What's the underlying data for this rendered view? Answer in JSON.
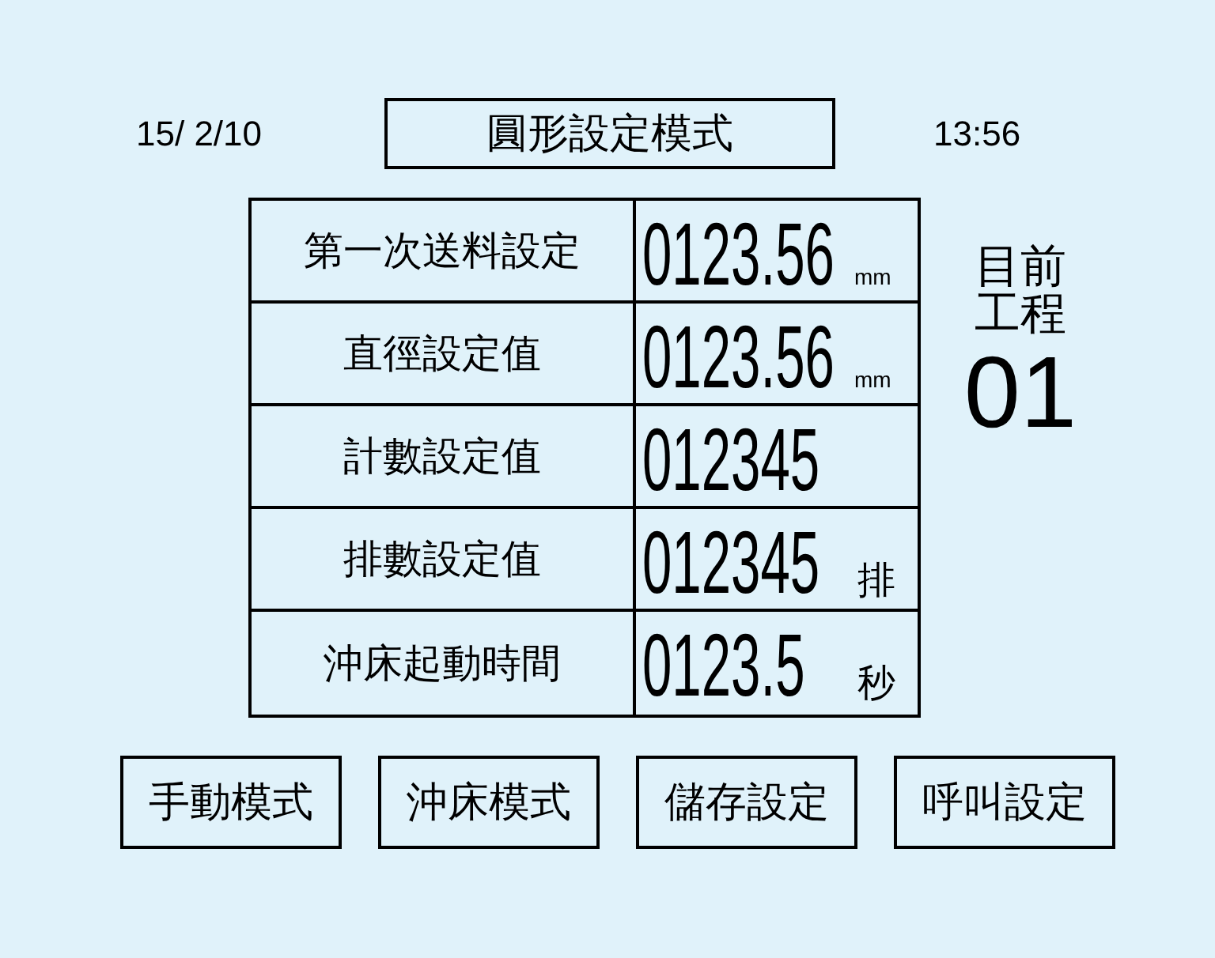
{
  "header": {
    "date": "15/ 2/10",
    "mode_title": "圓形設定模式",
    "time": "13:56"
  },
  "settings": [
    {
      "label": "第一次送料設定",
      "value": "0123.56",
      "unit": "mm",
      "kind": "length"
    },
    {
      "label": "直徑設定值",
      "value": "0123.56",
      "unit": "mm",
      "kind": "length"
    },
    {
      "label": "計數設定值",
      "value": "012345"
    },
    {
      "label": "排數設定值",
      "value": "012345",
      "unit": "排",
      "kind": "count"
    },
    {
      "label": "沖床起動時間",
      "value": "0123.5",
      "unit": "秒",
      "kind": "time"
    }
  ],
  "process": {
    "label": "目前工程",
    "number": "01"
  },
  "buttons": [
    "手動模式",
    "沖床模式",
    "儲存設定",
    "呼叫設定"
  ]
}
